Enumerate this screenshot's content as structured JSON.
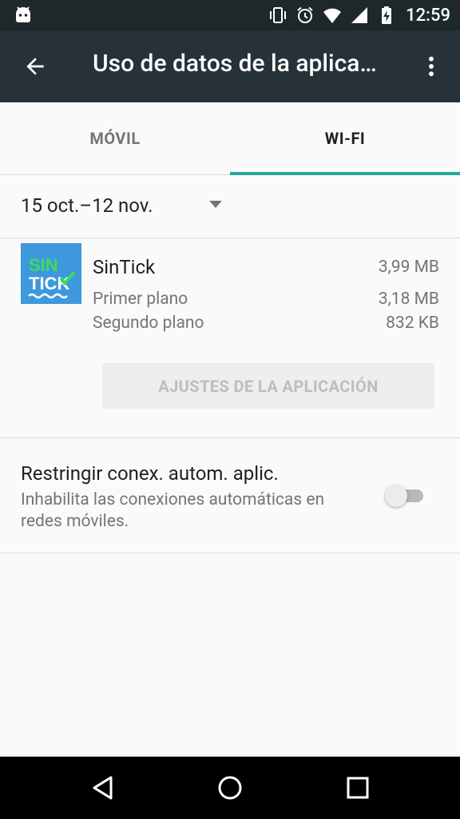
{
  "status_bar": {
    "time": "12:59",
    "icons": [
      "android-icon",
      "vibrate-icon",
      "alarm-icon",
      "wifi-icon",
      "signal-icon",
      "battery-charging-icon"
    ]
  },
  "app_bar": {
    "title": "Uso de datos de la aplica…",
    "back_icon": "arrow-back-icon",
    "menu_icon": "more-vert-icon"
  },
  "tabs": [
    {
      "label": "MÓVIL",
      "active": false
    },
    {
      "label": "WI-FI",
      "active": true
    }
  ],
  "date_range": {
    "label": "15 oct.–12 nov."
  },
  "app_usage": {
    "name": "SinTick",
    "total": "3,99 MB",
    "icon_text_top": "SIN",
    "icon_text_bottom": "TICK",
    "rows": [
      {
        "label": "Primer plano",
        "value": "3,18 MB"
      },
      {
        "label": "Segundo plano",
        "value": "832 KB"
      }
    ],
    "settings_button": "AJUSTES DE LA APLICACIÓN"
  },
  "restrict": {
    "title": "Restringir conex. autom. aplic.",
    "subtitle": "Inhabilita las conexiones automáticas en redes móviles.",
    "enabled": false
  },
  "colors": {
    "status_bar": "#1e282b",
    "app_bar": "#263238",
    "accent": "#26a69a",
    "app_icon_bg": "#3e98dd",
    "app_icon_green": "#3ddc5a"
  }
}
